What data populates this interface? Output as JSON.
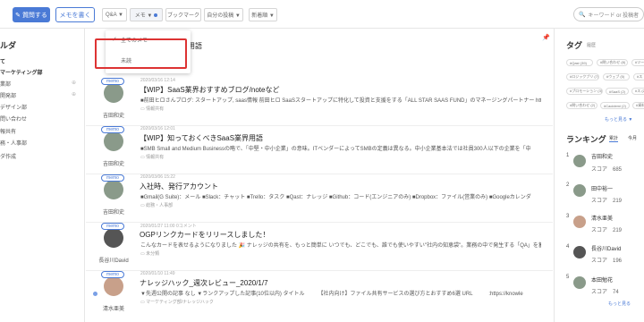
{
  "topbar": {
    "ask_label": "質問する",
    "memo_label": "メモを書く",
    "filters": [
      "Q&A ▼",
      "メモ ▼",
      "ブックマーク",
      "自分の投稿 ▼",
      "新着順 ▼"
    ],
    "search_placeholder": "キーワード or 投稿者"
  },
  "sidebar": {
    "title": "ルダ",
    "items": [
      "て",
      "マーケティング部",
      "業部",
      "開発部",
      "デザイン部",
      "問い合わせ",
      "報共有",
      "務・人事部",
      "ダ作成"
    ]
  },
  "dropdown": {
    "items": [
      "全てのメモ",
      "未読"
    ]
  },
  "feed": {
    "partial_title": "用語",
    "posts": [
      {
        "badge": "memo",
        "author": "吉田和史",
        "date": "2020/03/16 12:14",
        "title": "【WIP】SaaS業界おすすめブログ/noteなど",
        "body": "■前田ヒロさんブログ: スタートアップ, saas情報 前田ヒロ SaaSスタートアップに特化して投資と支援をする「ALL STAR SAAS FUND」のマネージングパートナー https://",
        "folder": "情報共有"
      },
      {
        "badge": "memo",
        "author": "吉田和史",
        "date": "2020/03/16 12:01",
        "title": "【WIP】知っておくべきSaaS業界用語",
        "body": "■SMB Small and Medium Businessの略で、「中堅・中小企業」の意味。ITベンダーによってSMBの定義は異なる。中小企業基本法では社員300人以下の企業を「中",
        "folder": "情報共有"
      },
      {
        "badge": "memo",
        "author": "吉田和史",
        "date": "2020/03/06 15:22",
        "title": "入社時、発行アカウント",
        "body": "■Gmail(G Suite)：メール ■Slack：チャット ■Trello：タスク ■Qast：ナレッジ ■Github：コード(エンジニアのみ) ■Dropbox：ファイル(営業のみ) ■Googleカレンダ",
        "folder": "総務・人事部"
      },
      {
        "badge": "memo",
        "author": "長谷川David",
        "date": "2020/01/27 11:00  0コメント",
        "title": "OGPリンクカードをリリースしました！",
        "body": "こんなカードを表せるようになりました 🎉 ナレッジの共有を、もっと簡単に いつでも、どこでも、誰でも使いやすい\"社内の知恵袋\"。業務の中で発生する「QA」を蓄積",
        "folder": "未分類"
      },
      {
        "badge": "memo",
        "author": "清水亜美",
        "date": "2020/01/10 11:49",
        "title": "ナレッジハック_週次レビュー_2020/1/7",
        "body": "▼先週公開の記事 なし ▼ランクアップした記事(10位以内) タイトル　　　【社内向け】ファイル共有サービスの選び方とおすすめ6選 URL　　　:https://knowle",
        "folder": "マーケティング部/ナレッジハック"
      }
    ]
  },
  "right": {
    "tag_title": "タグ",
    "tag_sub": "履歴",
    "tags": [
      "#Qast (39)",
      "#問い合わせ (8)",
      "#ツール",
      "#ロジックプリ (7)",
      "#ウェブ (5)",
      "#ス",
      "#プロモーション (3)",
      "#SaaS (2)",
      "#ス (2)",
      "#問い合わせ (2)",
      "#Cacidemi (2)",
      "#資料"
    ],
    "more1": "もっと見る ▼",
    "rank_title": "ランキング",
    "rank_tabs": [
      "累計",
      "今月"
    ],
    "ranks": [
      {
        "n": "1",
        "name": "吉田和史",
        "score": "スコア　685"
      },
      {
        "n": "2",
        "name": "田中裕一",
        "score": "スコア　219"
      },
      {
        "n": "3",
        "name": "清水亜美",
        "score": "スコア　219"
      },
      {
        "n": "4",
        "name": "長谷川David",
        "score": "スコア　196"
      },
      {
        "n": "5",
        "name": "本田勉花",
        "score": "スコア　74"
      }
    ],
    "more2": "もっと見る"
  }
}
